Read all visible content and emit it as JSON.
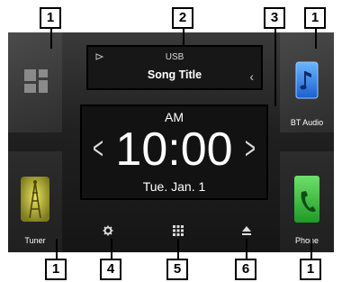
{
  "callouts": {
    "c1_top_left": "1",
    "c2": "2",
    "c3": "3",
    "c1_top_right": "1",
    "c1_bottom_left": "1",
    "c4": "4",
    "c5": "5",
    "c6": "6",
    "c1_bottom_right": "1"
  },
  "source": {
    "name": "USB",
    "song_title": "Song Title"
  },
  "clock": {
    "ampm": "AM",
    "time": "10:00",
    "date": "Tue.  Jan.  1"
  },
  "tiles": {
    "bt_audio_label": "BT Audio",
    "tuner_label": "Tuner",
    "phone_label": "Phone"
  },
  "icons": {
    "apps": "apps-grid-icon",
    "bt_audio": "music-note-icon",
    "tuner": "antenna-tower-icon",
    "phone": "phone-icon",
    "settings": "gear-icon",
    "menu": "grid-menu-icon",
    "eject": "eject-icon",
    "play": "play-icon"
  },
  "colors": {
    "bt_blue": "#2f7fe8",
    "phone_green": "#3dbd3d",
    "tuner_yellow": "#c9c23a"
  }
}
